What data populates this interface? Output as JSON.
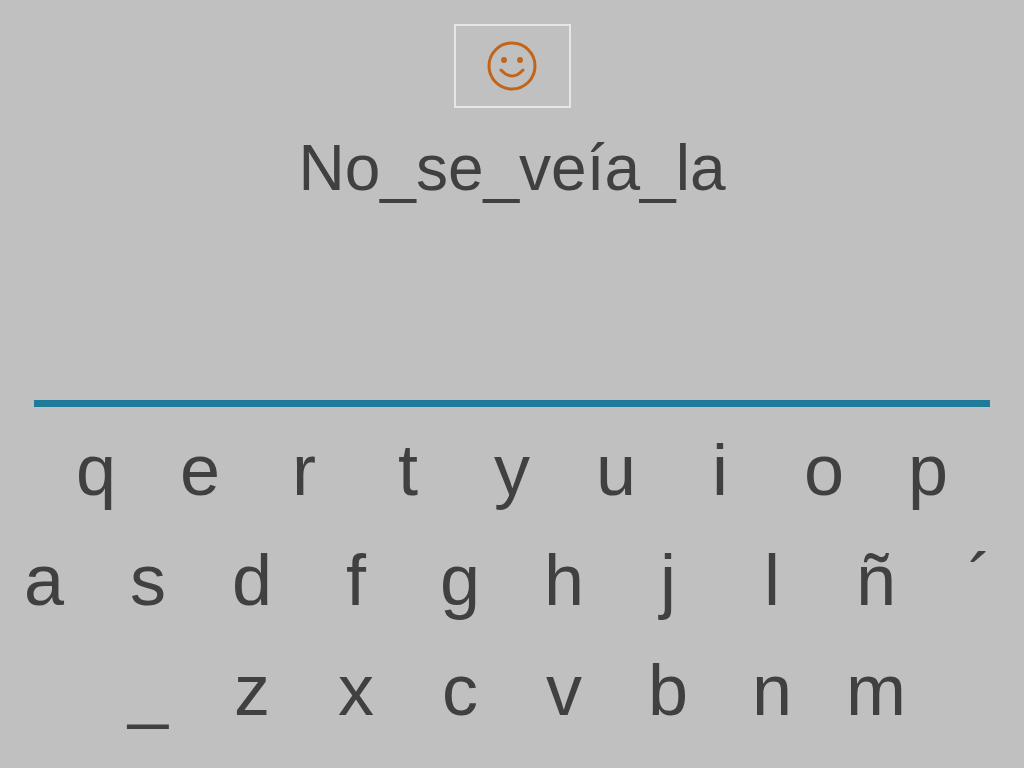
{
  "sentence": "No_se_veía_la",
  "keyboard": {
    "rows": [
      [
        "q",
        "e",
        "r",
        "t",
        "y",
        "u",
        "i",
        "o",
        "p"
      ],
      [
        "a",
        "s",
        "d",
        "f",
        "g",
        "h",
        "j",
        "l",
        "ñ",
        "´"
      ],
      [
        "_",
        "z",
        "x",
        "c",
        "v",
        "b",
        "n",
        "m"
      ]
    ]
  }
}
